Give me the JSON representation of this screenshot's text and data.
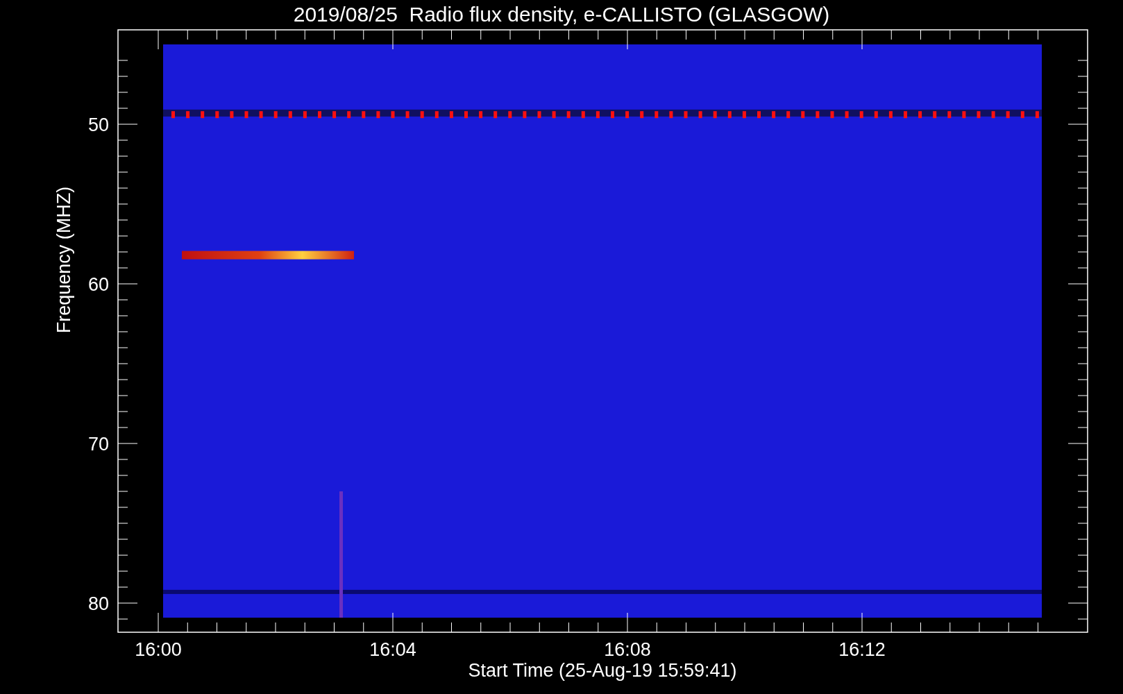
{
  "title": "2019/08/25  Radio flux density, e-CALLISTO (GLASGOW)",
  "plot": {
    "ylabel": "Frequency (MHZ)",
    "xlabel": "Start Time (25-Aug-19 15:59:41)",
    "yticks": [
      "50",
      "60",
      "70",
      "80"
    ],
    "xticks": [
      "16:00",
      "16:04",
      "16:08",
      "16:12"
    ]
  }
}
